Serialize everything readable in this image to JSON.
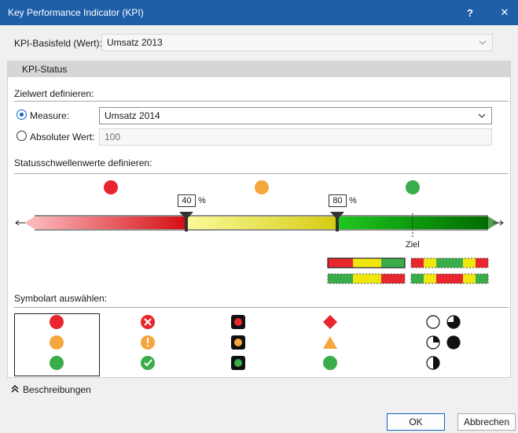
{
  "window": {
    "title": "Key Performance Indicator (KPI)",
    "help_label": "?",
    "close_label": "✕"
  },
  "basisfeld": {
    "label": "KPI-Basisfeld (Wert):",
    "value": "Umsatz 2013"
  },
  "tab": {
    "label": "KPI-Status"
  },
  "zielwert": {
    "heading": "Zielwert definieren:",
    "measure_label": "Measure:",
    "measure_value": "Umsatz 2014",
    "absolute_label": "Absoluter Wert:",
    "absolute_value": "100"
  },
  "schwellen": {
    "heading": "Statusschwellenwerte definieren:",
    "threshold1": "40",
    "threshold2": "80",
    "percent_sign": "%",
    "ziel_label": "Ziel",
    "colors": {
      "red": "#e8262d",
      "amber": "#f5a73d",
      "green": "#3aac4a"
    }
  },
  "symbolart": {
    "heading": "Symbolart auswählen:"
  },
  "footer": {
    "beschreibungen_label": "Beschreibungen",
    "ok_label": "OK",
    "cancel_label": "Abbrechen"
  },
  "colors": {
    "titlebar": "#1f5fa8",
    "accent": "#0a64c8"
  }
}
